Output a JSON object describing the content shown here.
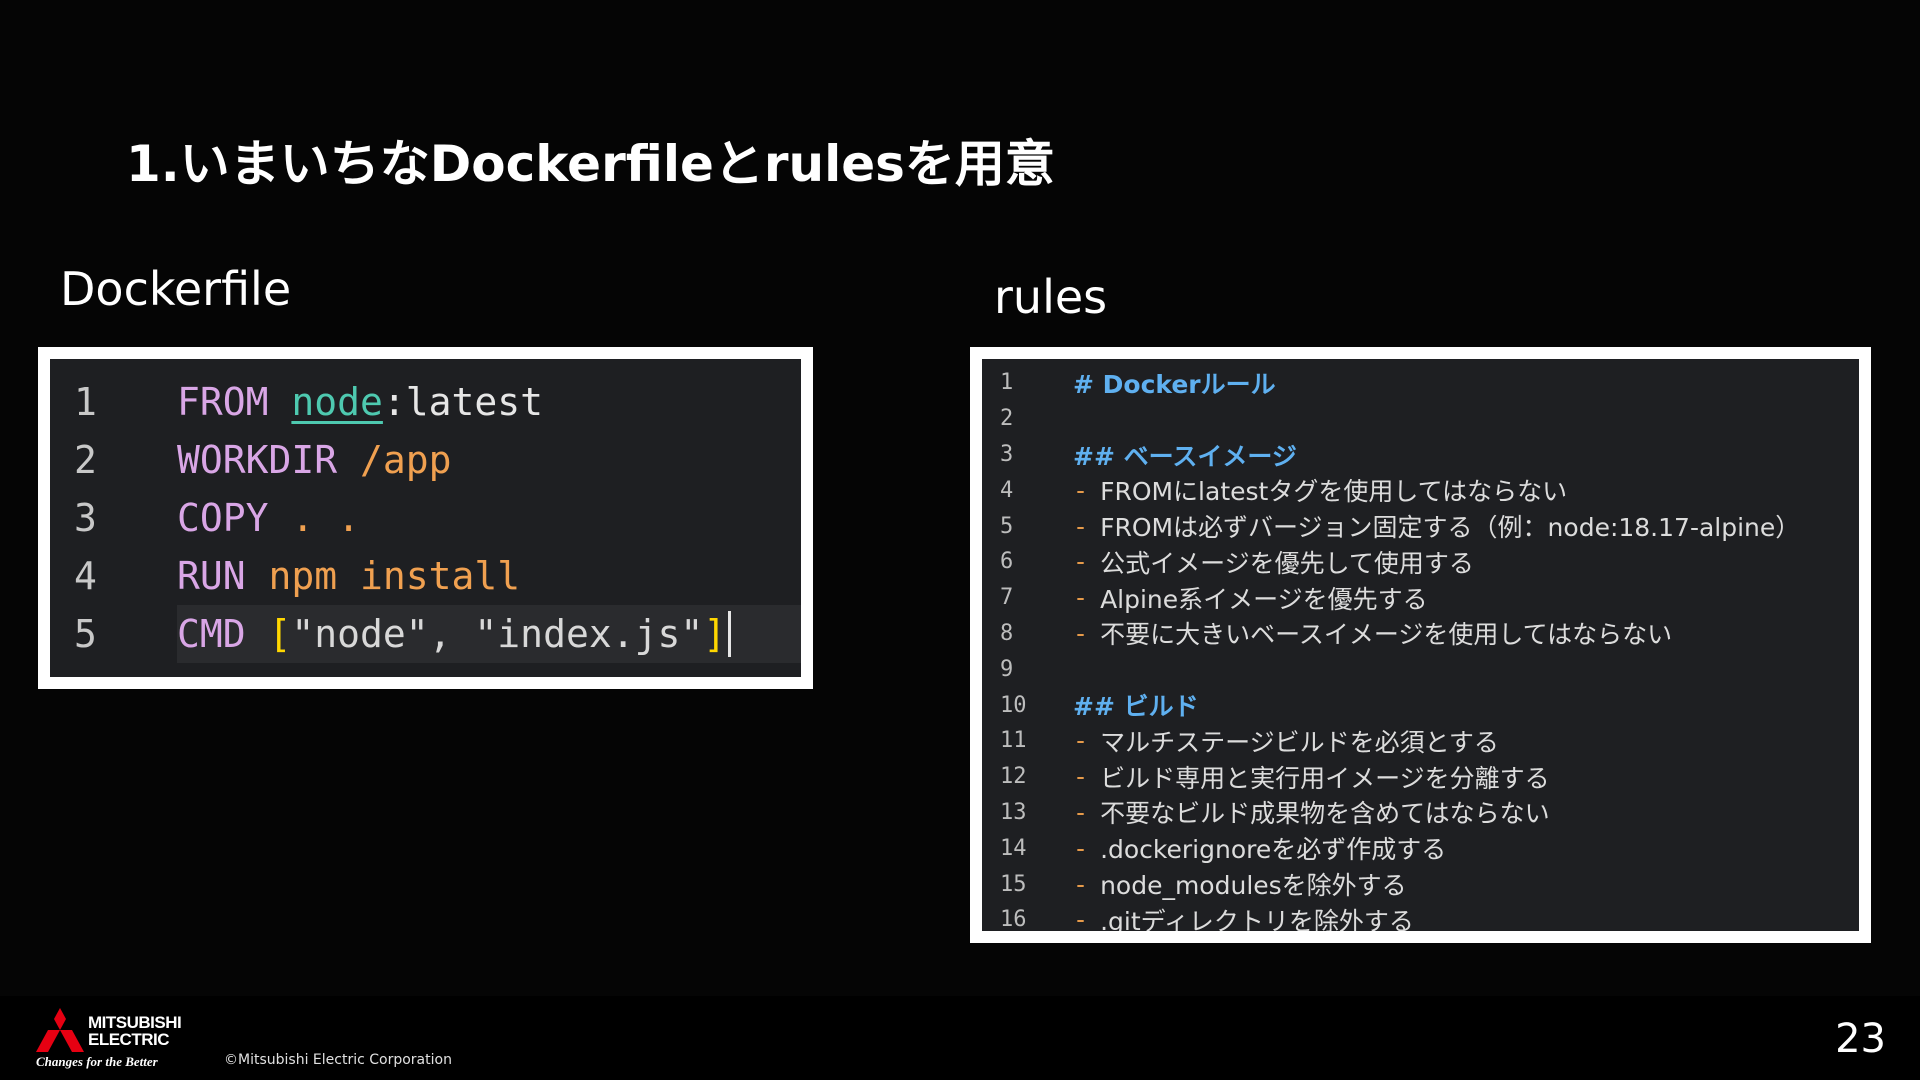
{
  "slide": {
    "title": "1.いまいちなDockerfileとrulesを用意",
    "page_number": "23",
    "copyright": "©Mitsubishi Electric Corporation"
  },
  "dockerfile": {
    "label": "Dockerfile",
    "lines": [
      {
        "no": "1",
        "tokens": [
          [
            "kw",
            "FROM "
          ],
          [
            "id",
            "node"
          ],
          [
            "plain",
            ":latest"
          ]
        ]
      },
      {
        "no": "2",
        "tokens": [
          [
            "kw",
            "WORKDIR "
          ],
          [
            "path",
            "/app"
          ]
        ]
      },
      {
        "no": "3",
        "tokens": [
          [
            "kw",
            "COPY "
          ],
          [
            "path",
            ". ."
          ]
        ]
      },
      {
        "no": "4",
        "tokens": [
          [
            "kw",
            "RUN "
          ],
          [
            "cmd",
            "npm install"
          ]
        ]
      },
      {
        "no": "5",
        "tokens": [
          [
            "kw",
            "CMD "
          ],
          [
            "brk",
            "["
          ],
          [
            "str",
            "\"node\", \"index.js\""
          ],
          [
            "brk",
            "]"
          ]
        ]
      }
    ]
  },
  "rules": {
    "label": "rules",
    "lines": [
      {
        "no": "1",
        "type": "heading",
        "text": "# Dockerルール"
      },
      {
        "no": "2",
        "type": "blank",
        "text": ""
      },
      {
        "no": "3",
        "type": "heading",
        "text": "## ベースイメージ"
      },
      {
        "no": "4",
        "type": "item",
        "text": "FROMにlatestタグを使用してはならない"
      },
      {
        "no": "5",
        "type": "item",
        "text": "FROMは必ずバージョン固定する（例：node:18.17-alpine）"
      },
      {
        "no": "6",
        "type": "item",
        "text": "公式イメージを優先して使用する"
      },
      {
        "no": "7",
        "type": "item",
        "text": "Alpine系イメージを優先する"
      },
      {
        "no": "8",
        "type": "item",
        "text": "不要に大きいベースイメージを使用してはならない"
      },
      {
        "no": "9",
        "type": "blank",
        "text": ""
      },
      {
        "no": "10",
        "type": "heading",
        "text": "## ビルド"
      },
      {
        "no": "11",
        "type": "item",
        "text": "マルチステージビルドを必須とする"
      },
      {
        "no": "12",
        "type": "item",
        "text": "ビルド専用と実行用イメージを分離する"
      },
      {
        "no": "13",
        "type": "item",
        "text": "不要なビルド成果物を含めてはならない"
      },
      {
        "no": "14",
        "type": "item",
        "text": ".dockerignoreを必ず作成する"
      },
      {
        "no": "15",
        "type": "item",
        "text": "node_modulesを除外する"
      },
      {
        "no": "16",
        "type": "item",
        "text": ".gitディレクトリを除外する"
      }
    ]
  },
  "brand": {
    "logo_line1": "MITSUBISHI",
    "logo_line2": "ELECTRIC",
    "tagline": "Changes for the Better",
    "logo_icon": "three-diamonds-icon",
    "logo_color": "#e60012"
  }
}
